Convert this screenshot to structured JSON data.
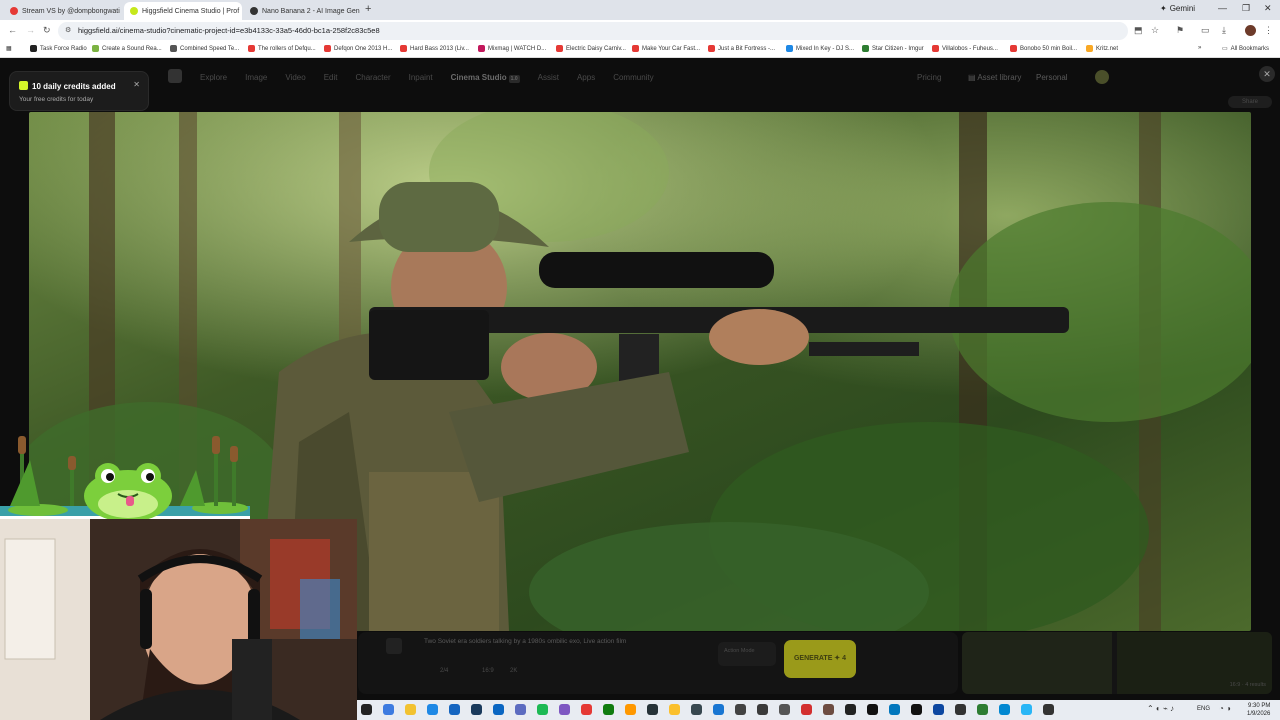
{
  "browser": {
    "tabs": [
      {
        "title": "Stream VS by @dompbongwati",
        "color": "#e53935",
        "active": false
      },
      {
        "title": "Higgsfield Cinema Studio | Prof",
        "color": "#c6e81c",
        "active": true
      },
      {
        "title": "Nano Banana 2 - AI Image Gen",
        "color": "#333333",
        "active": false
      }
    ],
    "gemini_label": "Gemini",
    "url": "higgsfield.ai/cinema-studio?cinematic-project-id=e3b4133c-33a5-46d0-bc1a-258f2c83c5e8",
    "bookmarks": [
      {
        "label": "Task Force Radio",
        "color": "#222222"
      },
      {
        "label": "Create a Sound Rea...",
        "color": "#7cb342"
      },
      {
        "label": "Combined Speed Te...",
        "color": "#555555"
      },
      {
        "label": "The rollers of Defqu...",
        "color": "#e53935"
      },
      {
        "label": "Defqon One 2013 H...",
        "color": "#e53935"
      },
      {
        "label": "Hard Bass 2013 (Liv...",
        "color": "#e53935"
      },
      {
        "label": "Mixmag | WATCH D...",
        "color": "#c2185b"
      },
      {
        "label": "Electric Daisy Carniv...",
        "color": "#e53935"
      },
      {
        "label": "Make Your Car Fast...",
        "color": "#e53935"
      },
      {
        "label": "Just a Bit Fortress -...",
        "color": "#e53935"
      },
      {
        "label": "Mixed In Key - DJ S...",
        "color": "#1e88e5"
      },
      {
        "label": "Star Citizen - Imgur",
        "color": "#2e7d32"
      },
      {
        "label": "Villalobos - Fuheus...",
        "color": "#e53935"
      },
      {
        "label": "Bonobo 50 min Boil...",
        "color": "#e53935"
      },
      {
        "label": "Kritz.net",
        "color": "#f9a825"
      }
    ],
    "all_bookmarks": "All Bookmarks"
  },
  "site": {
    "nav": [
      "Explore",
      "Image",
      "Video",
      "Edit",
      "Character",
      "Inpaint",
      "Cinema Studio",
      "Assist",
      "Apps",
      "Community"
    ],
    "active_nav": "Cinema Studio",
    "badge": "1.0",
    "pricing": "Pricing",
    "asset_library": "Asset library",
    "personal": "Personal",
    "share": "Share"
  },
  "toast": {
    "title": "10 daily credits added",
    "subtitle": "Your free credits for today"
  },
  "prompt": {
    "text": "Two Soviet era soldiers talking by a 1980s ombilic exo, Live action film",
    "meta1": "2/4",
    "meta2": "16:9",
    "meta3": "2K",
    "action_mode": "Action Mode",
    "generate_label": "GENERATE ✦ 4",
    "ratio": "16:9 · 4 results"
  },
  "taskbar": {
    "lang": "ENG",
    "time": "9:30 PM",
    "date": "1/9/2026"
  }
}
